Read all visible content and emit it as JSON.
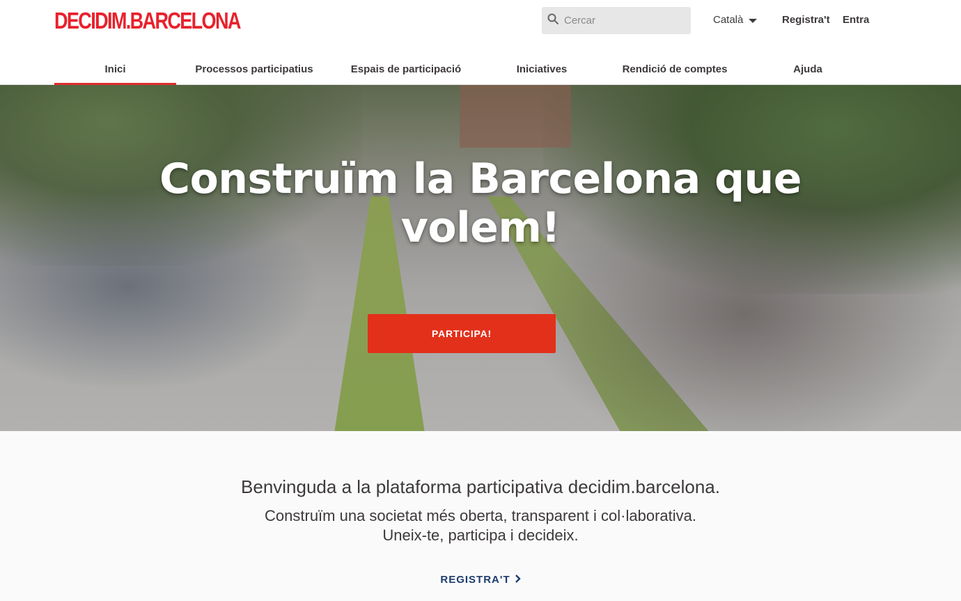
{
  "header": {
    "logo": "DECIDIM.BARCELONA",
    "search_placeholder": "Cercar",
    "language": "Català",
    "register": "Registra't",
    "login": "Entra"
  },
  "nav": {
    "items": [
      {
        "label": "Inici",
        "active": true
      },
      {
        "label": "Processos participatius",
        "active": false
      },
      {
        "label": "Espais de participació",
        "active": false
      },
      {
        "label": "Iniciatives",
        "active": false
      },
      {
        "label": "Rendició de comptes",
        "active": false
      },
      {
        "label": "Ajuda",
        "active": false
      }
    ]
  },
  "hero": {
    "title": "Construïm la Barcelona que volem!",
    "cta": "PARTICIPA!"
  },
  "intro": {
    "line1": "Benvinguda a la plataforma participativa decidim.barcelona.",
    "line2": "Construïm una societat més oberta, transparent i col·laborativa.",
    "line3": "Uneix-te, participa i decideix.",
    "register_link": "REGISTRA'T"
  },
  "colors": {
    "brand_red": "#e8212c",
    "cta_red": "#e3301b",
    "link_blue": "#1d3b6e",
    "nav_active": "#e02d2d"
  }
}
